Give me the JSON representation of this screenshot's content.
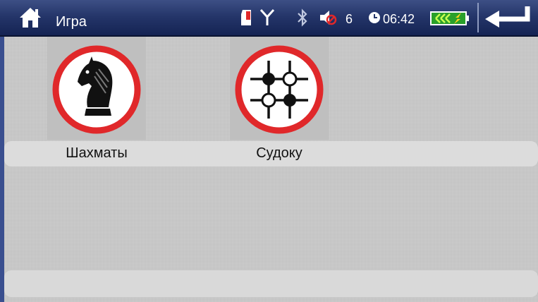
{
  "header": {
    "title": "Игра",
    "bluetooth_count": "6",
    "time": "06:42"
  },
  "icons": {
    "home": "home-icon",
    "sd": "sd-card-icon",
    "antenna": "antenna-icon",
    "bluetooth": "bluetooth-icon",
    "volume_muted": "volume-muted-icon",
    "clock": "clock-icon",
    "battery": "battery-charging-icon",
    "back": "back-arrow-icon"
  },
  "apps": [
    {
      "label": "Шахматы",
      "icon": "chess-knight-icon"
    },
    {
      "label": "Судоку",
      "icon": "sudoku-icon"
    }
  ],
  "colors": {
    "header_bg": "#25366a",
    "icon_ring": "#e0282a",
    "battery": "#37d437"
  }
}
